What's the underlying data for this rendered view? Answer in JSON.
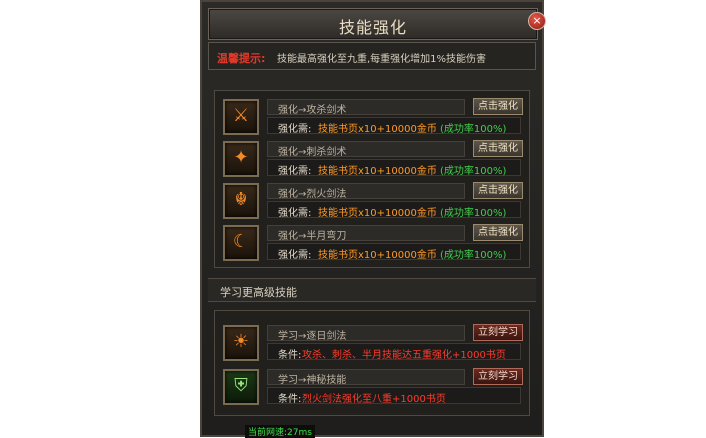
{
  "window": {
    "title": "技能强化",
    "close_glyph": "×"
  },
  "tip": {
    "label": "温馨提示:",
    "text": "技能最高强化至九重,每重强化增加1%技能伤害"
  },
  "enhance": {
    "rows": [
      {
        "name": "强化→攻杀剑术",
        "req_label": "强化需:",
        "cost": "技能书页x10+10000金币",
        "success": "(成功率100%)",
        "button": "点击强化",
        "icon": "sword-strike-icon"
      },
      {
        "name": "强化→刺杀剑术",
        "req_label": "强化需:",
        "cost": "技能书页x10+10000金币",
        "success": "(成功率100%)",
        "button": "点击强化",
        "icon": "blade-thrust-icon"
      },
      {
        "name": "强化→烈火剑法",
        "req_label": "强化需:",
        "cost": "技能书页x10+10000金币",
        "success": "(成功率100%)",
        "button": "点击强化",
        "icon": "fire-dragon-icon"
      },
      {
        "name": "强化→半月弯刀",
        "req_label": "强化需:",
        "cost": "技能书页x10+10000金币",
        "success": "(成功率100%)",
        "button": "点击强化",
        "icon": "crescent-blade-icon"
      }
    ]
  },
  "learn": {
    "heading": "学习更高级技能",
    "rows": [
      {
        "name": "学习→逐日剑法",
        "req_label": "条件:",
        "requirement": "攻杀、刺杀、半月技能达五重强化+1000书页",
        "button": "立刻学习",
        "icon": "sun-slash-icon"
      },
      {
        "name": "学习→神秘技能",
        "req_label": "条件:",
        "requirement": "烈火剑法强化至八重+1000书页",
        "button": "立刻学习",
        "icon": "mystery-shield-icon"
      }
    ]
  },
  "footer": {
    "text": "当前网速:27ms"
  },
  "colors": {
    "accent_orange": "#ff9a26",
    "success_green": "#3fd14a",
    "warning_red": "#e23a2a"
  }
}
